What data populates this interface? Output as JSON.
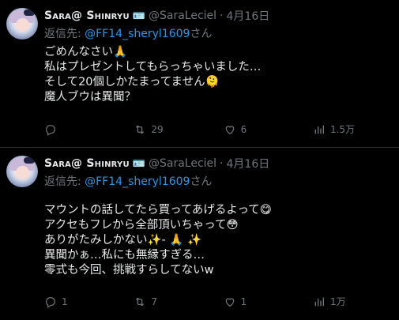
{
  "tweets": [
    {
      "author": {
        "name": "Sara@ Shinryu",
        "name_icon": "🪪",
        "handle": "@SaraLeciel",
        "date": "4月16日"
      },
      "reply": {
        "prefix": "返信先: ",
        "mention": "@FF14_sheryl1609",
        "suffix": "さん"
      },
      "lines": [
        "ごめんなさい🙏",
        "私はプレゼントしてもらっちゃいました…",
        "そして20個しかたまってません🫠",
        "魔人ブウは異聞？"
      ],
      "actions": {
        "reply": "",
        "retweet": "29",
        "like": "6",
        "views": "1.5万"
      }
    },
    {
      "author": {
        "name": "Sara@ Shinryu",
        "name_icon": "🪪",
        "handle": "@SaraLeciel",
        "date": "4月16日"
      },
      "reply": {
        "prefix": "返信先: ",
        "mention": "@FF14_sheryl1609",
        "suffix": "さん"
      },
      "lines": [
        "マウントの話してたら買ってあげるよって😋",
        "アクセもフレから全部頂いちゃって😳",
        "ありがたみしかない✨- 🙏 ✨",
        "異聞かぁ…私にも無縁すぎる…",
        "零式も今回、挑戦すらしてないw"
      ],
      "actions": {
        "reply": "1",
        "retweet": "7",
        "like": "1",
        "views": "1万"
      }
    }
  ],
  "icons": {
    "reply": "reply-icon",
    "retweet": "retweet-icon",
    "like": "like-icon",
    "views": "views-icon"
  },
  "colors": {
    "background": "#000000",
    "text": "#e7e9ea",
    "muted": "#71767b",
    "link": "#1d9bf0",
    "divider": "#2f3336"
  }
}
